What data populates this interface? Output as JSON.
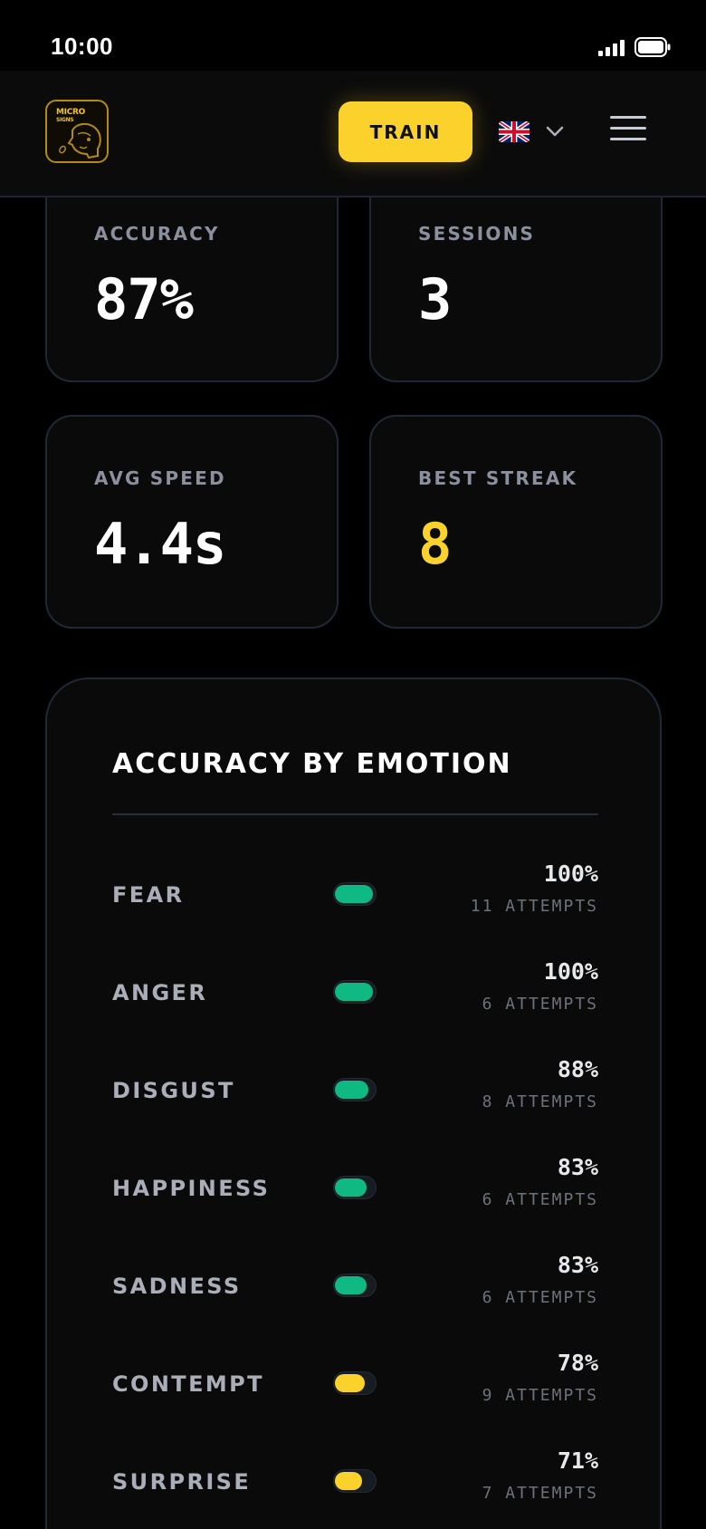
{
  "status_bar": {
    "time": "10:00"
  },
  "header": {
    "logo_text_line1": "MICRO",
    "logo_text_line2": "SIGNS",
    "train_label": "TRAIN",
    "language_icon": "uk-flag-icon",
    "menu_icon": "hamburger-menu-icon"
  },
  "stats": {
    "accuracy": {
      "label": "ACCURACY",
      "value": "87%"
    },
    "sessions": {
      "label": "SESSIONS",
      "value": "3"
    },
    "avg_speed": {
      "label": "AVG SPEED",
      "value": "4.4s"
    },
    "best_streak": {
      "label": "BEST STREAK",
      "value": "8"
    }
  },
  "emotion_panel": {
    "title": "ACCURACY BY EMOTION",
    "rows": [
      {
        "name": "FEAR",
        "percent": "100%",
        "attempts": "11 ATTEMPTS",
        "fill": 1.0,
        "color": "#10b981"
      },
      {
        "name": "ANGER",
        "percent": "100%",
        "attempts": "6 ATTEMPTS",
        "fill": 1.0,
        "color": "#10b981"
      },
      {
        "name": "DISGUST",
        "percent": "88%",
        "attempts": "8 ATTEMPTS",
        "fill": 0.88,
        "color": "#10b981"
      },
      {
        "name": "HAPPINESS",
        "percent": "83%",
        "attempts": "6 ATTEMPTS",
        "fill": 0.83,
        "color": "#10b981"
      },
      {
        "name": "SADNESS",
        "percent": "83%",
        "attempts": "6 ATTEMPTS",
        "fill": 0.83,
        "color": "#10b981"
      },
      {
        "name": "CONTEMPT",
        "percent": "78%",
        "attempts": "9 ATTEMPTS",
        "fill": 0.78,
        "color": "#fad22b"
      },
      {
        "name": "SURPRISE",
        "percent": "71%",
        "attempts": "7 ATTEMPTS",
        "fill": 0.71,
        "color": "#fad22b"
      }
    ]
  },
  "colors": {
    "accent_yellow": "#fad22b",
    "success_green": "#10b981",
    "card_border": "#1f2935",
    "background": "#000000"
  }
}
